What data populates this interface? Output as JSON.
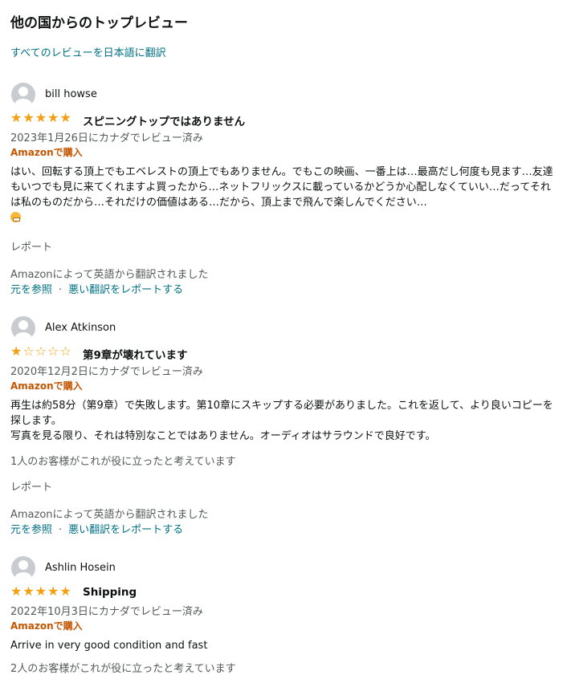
{
  "section_title": "他の国からのトップレビュー",
  "translate_all_link": "すべてのレビューを日本語に翻訳",
  "reviews": [
    {
      "reviewer": "bill howse",
      "rating": 5,
      "title": "スピニングトップではありません",
      "meta": "2023年1月26日にカナダでレビュー済み",
      "verified": "Amazonで購入",
      "body": "はい、回転する頂上でもエベレストの頂上でもありません。でもこの映画、一番上は…最高だし何度も見ます…友達もいつでも見に来てくれますよ買ったから…ネットフリックスに載っているかどうか心配しなくていい…だってそれは私のものだから…それだけの価値はある…だから、頂上まで飛んで楽しんでください…",
      "emoji": "grinning-face",
      "helpful": "",
      "report": "レポート",
      "translated_note": "Amazonによって英語から翻訳されました",
      "see_original": "元を参照",
      "separator": "·",
      "report_translation": "悪い翻訳をレポートする"
    },
    {
      "reviewer": "Alex Atkinson",
      "rating": 1,
      "title": "第9章が壊れています",
      "meta": "2020年12月2日にカナダでレビュー済み",
      "verified": "Amazonで購入",
      "body_lines": [
        "再生は約58分（第9章）で失敗します。第10章にスキップする必要がありました。これを返して、より良いコピーを探します。",
        "写真を見る限り、それは特別なことではありません。オーディオはサラウンドで良好です。"
      ],
      "helpful": "1人のお客様がこれが役に立ったと考えています",
      "report": "レポート",
      "translated_note": "Amazonによって英語から翻訳されました",
      "see_original": "元を参照",
      "separator": "·",
      "report_translation": "悪い翻訳をレポートする"
    },
    {
      "reviewer": "Ashlin Hosein",
      "rating": 5,
      "title": "Shipping",
      "meta": "2022年10月3日にカナダでレビュー済み",
      "verified": "Amazonで購入",
      "body": "Arrive in very good condition and fast",
      "helpful": "2人のお客様がこれが役に立ったと考えています"
    }
  ],
  "colors": {
    "link": "#007185",
    "star": "#f59f10",
    "verified": "#c45500",
    "meta": "#565959"
  }
}
